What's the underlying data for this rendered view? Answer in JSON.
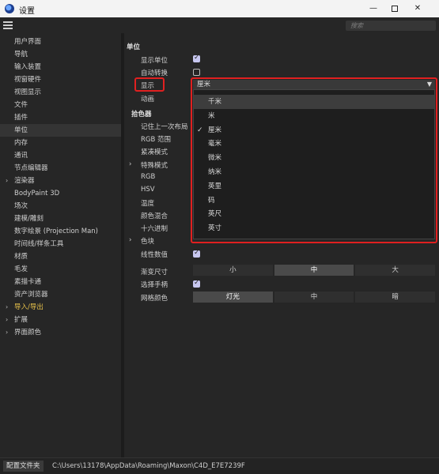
{
  "window": {
    "title": "设置"
  },
  "toolbar": {
    "search_placeholder": "搜索"
  },
  "sidebar": {
    "items": [
      {
        "label": "用户界面"
      },
      {
        "label": "导航"
      },
      {
        "label": "输入装置"
      },
      {
        "label": "视窗硬件"
      },
      {
        "label": "视图显示"
      },
      {
        "label": "文件"
      },
      {
        "label": "插件"
      },
      {
        "label": "单位",
        "active": true
      },
      {
        "label": "内存"
      },
      {
        "label": "通讯"
      },
      {
        "label": "节点编辑器"
      },
      {
        "label": "渲染器",
        "expandable": true
      },
      {
        "label": "BodyPaint 3D"
      },
      {
        "label": "场次"
      },
      {
        "label": "建模/雕刻"
      },
      {
        "label": "数字绘景 (Projection Man)"
      },
      {
        "label": "时间线/样条工具"
      },
      {
        "label": "材质"
      },
      {
        "label": "毛发"
      },
      {
        "label": "素描卡通"
      },
      {
        "label": "资产浏览器"
      },
      {
        "label": "导入/导出",
        "expandable": true,
        "highlight": true
      },
      {
        "label": "扩展",
        "expandable": true
      },
      {
        "label": "界面颜色",
        "expandable": true
      }
    ]
  },
  "main": {
    "section_units": "单位",
    "show_unit_label": "显示单位",
    "auto_convert_label": "自动转换",
    "display_label": "显示",
    "anim_label": "动画",
    "section_picker": "拾色器",
    "remember_label": "记住上一次布局",
    "rgb_range_label": "RGB 范围",
    "compact_label": "紧凑模式",
    "special_label": "特殊模式",
    "rgb_label": "RGB",
    "hsv_label": "HSV",
    "temp_label": "温度",
    "mix_label": "颜色混合",
    "hex_label": "十六进制",
    "swatch_label": "色块",
    "linear_label": "线性数值",
    "gradient_size_label": "渐变尺寸",
    "gradient_size_options": [
      "小",
      "中",
      "大"
    ],
    "gradient_size_selected": "中",
    "select_handle_label": "选择手柄",
    "grid_color_label": "网格颜色",
    "grid_color_options": [
      "灯光",
      "中",
      "暗"
    ],
    "grid_color_selected": "灯光",
    "display_select": {
      "value": "厘米",
      "options": [
        "千米",
        "米",
        "厘米",
        "毫米",
        "微米",
        "纳米",
        "英里",
        "码",
        "英尺",
        "英寸"
      ],
      "hovered": "千米",
      "checked": "厘米"
    }
  },
  "statusbar": {
    "button": "配置文件夹",
    "path": "C:\\Users\\13178\\AppData\\Roaming\\Maxon\\C4D_E7E7239F"
  },
  "colors": {
    "accent_highlight": "#e7c14a",
    "annotation_red": "#e02020"
  }
}
